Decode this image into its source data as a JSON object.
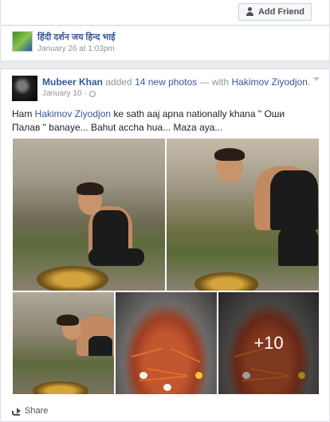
{
  "top": {
    "add_friend_label": "Add Friend"
  },
  "story1": {
    "title": "हिंदी दर्शन जय हिन्द भाई",
    "date": "January 26 at 1:03pm"
  },
  "story2": {
    "author": "Mubeer Khan",
    "verb": "added",
    "photo_count": "14 new photos",
    "with": "— with",
    "tagged": "Hakimov Ziyodjon",
    "period": ".",
    "date": "January 10",
    "message_pre": "Ham ",
    "message_tag": "Hakimov Ziyodjon",
    "message_post": " ke sath aaj apna nationally khana \" Оши Палав \" banaye... Bahut accha hua... Maza aya...",
    "more_photos": "+10",
    "share_label": "Share"
  }
}
